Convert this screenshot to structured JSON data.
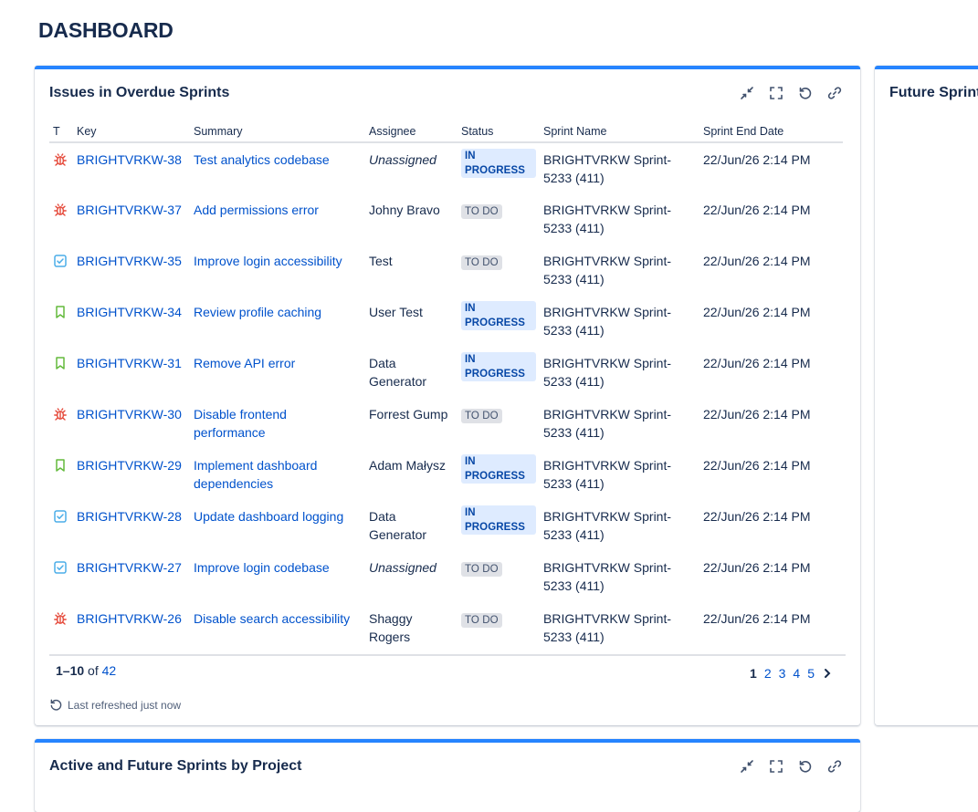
{
  "page": {
    "title": "DASHBOARD"
  },
  "gadget1": {
    "title": "Issues in Overdue Sprints",
    "columns": [
      "T",
      "Key",
      "Summary",
      "Assignee",
      "Status",
      "Sprint Name",
      "Sprint End Date"
    ],
    "rows": [
      {
        "type": "bug",
        "key": "BRIGHTVRKW-38",
        "summary": "Test analytics codebase",
        "assignee": "Unassigned",
        "status": "IN PROGRESS",
        "sprint": "BRIGHTVRKW Sprint-5233 (411)",
        "end": "22/Jun/26 2:14 PM"
      },
      {
        "type": "bug",
        "key": "BRIGHTVRKW-37",
        "summary": "Add permissions error",
        "assignee": "Johny Bravo",
        "status": "TO DO",
        "sprint": "BRIGHTVRKW Sprint-5233 (411)",
        "end": "22/Jun/26 2:14 PM"
      },
      {
        "type": "task",
        "key": "BRIGHTVRKW-35",
        "summary": "Improve login accessibility",
        "assignee": "Test",
        "status": "TO DO",
        "sprint": "BRIGHTVRKW Sprint-5233 (411)",
        "end": "22/Jun/26 2:14 PM"
      },
      {
        "type": "story",
        "key": "BRIGHTVRKW-34",
        "summary": "Review profile caching",
        "assignee": "User Test",
        "status": "IN PROGRESS",
        "sprint": "BRIGHTVRKW Sprint-5233 (411)",
        "end": "22/Jun/26 2:14 PM"
      },
      {
        "type": "story",
        "key": "BRIGHTVRKW-31",
        "summary": "Remove API error",
        "assignee": "Data Generator",
        "status": "IN PROGRESS",
        "sprint": "BRIGHTVRKW Sprint-5233 (411)",
        "end": "22/Jun/26 2:14 PM"
      },
      {
        "type": "bug",
        "key": "BRIGHTVRKW-30",
        "summary": "Disable frontend performance",
        "assignee": "Forrest Gump",
        "status": "TO DO",
        "sprint": "BRIGHTVRKW Sprint-5233 (411)",
        "end": "22/Jun/26 2:14 PM"
      },
      {
        "type": "story",
        "key": "BRIGHTVRKW-29",
        "summary": "Implement dashboard dependencies",
        "assignee": "Adam Małysz",
        "status": "IN PROGRESS",
        "sprint": "BRIGHTVRKW Sprint-5233 (411)",
        "end": "22/Jun/26 2:14 PM"
      },
      {
        "type": "task",
        "key": "BRIGHTVRKW-28",
        "summary": "Update dashboard logging",
        "assignee": "Data Generator",
        "status": "IN PROGRESS",
        "sprint": "BRIGHTVRKW Sprint-5233 (411)",
        "end": "22/Jun/26 2:14 PM"
      },
      {
        "type": "task",
        "key": "BRIGHTVRKW-27",
        "summary": "Improve login codebase",
        "assignee": "Unassigned",
        "status": "TO DO",
        "sprint": "BRIGHTVRKW Sprint-5233 (411)",
        "end": "22/Jun/26 2:14 PM"
      },
      {
        "type": "bug",
        "key": "BRIGHTVRKW-26",
        "summary": "Disable search accessibility",
        "assignee": "Shaggy Rogers",
        "status": "TO DO",
        "sprint": "BRIGHTVRKW Sprint-5233 (411)",
        "end": "22/Jun/26 2:14 PM"
      }
    ],
    "count_range": "1–10",
    "count_of": "of",
    "count_total": "42",
    "pages": [
      "1",
      "2",
      "3",
      "4",
      "5"
    ],
    "refreshed": "Last refreshed just now"
  },
  "gadget2": {
    "title": "Future Sprint"
  },
  "gadget3": {
    "title": "Active and Future Sprints by Project"
  },
  "colors": {
    "accent": "#2684ff",
    "link": "#0052cc",
    "bug": "#e5493a",
    "task": "#4bade8",
    "story": "#63ba3c"
  }
}
